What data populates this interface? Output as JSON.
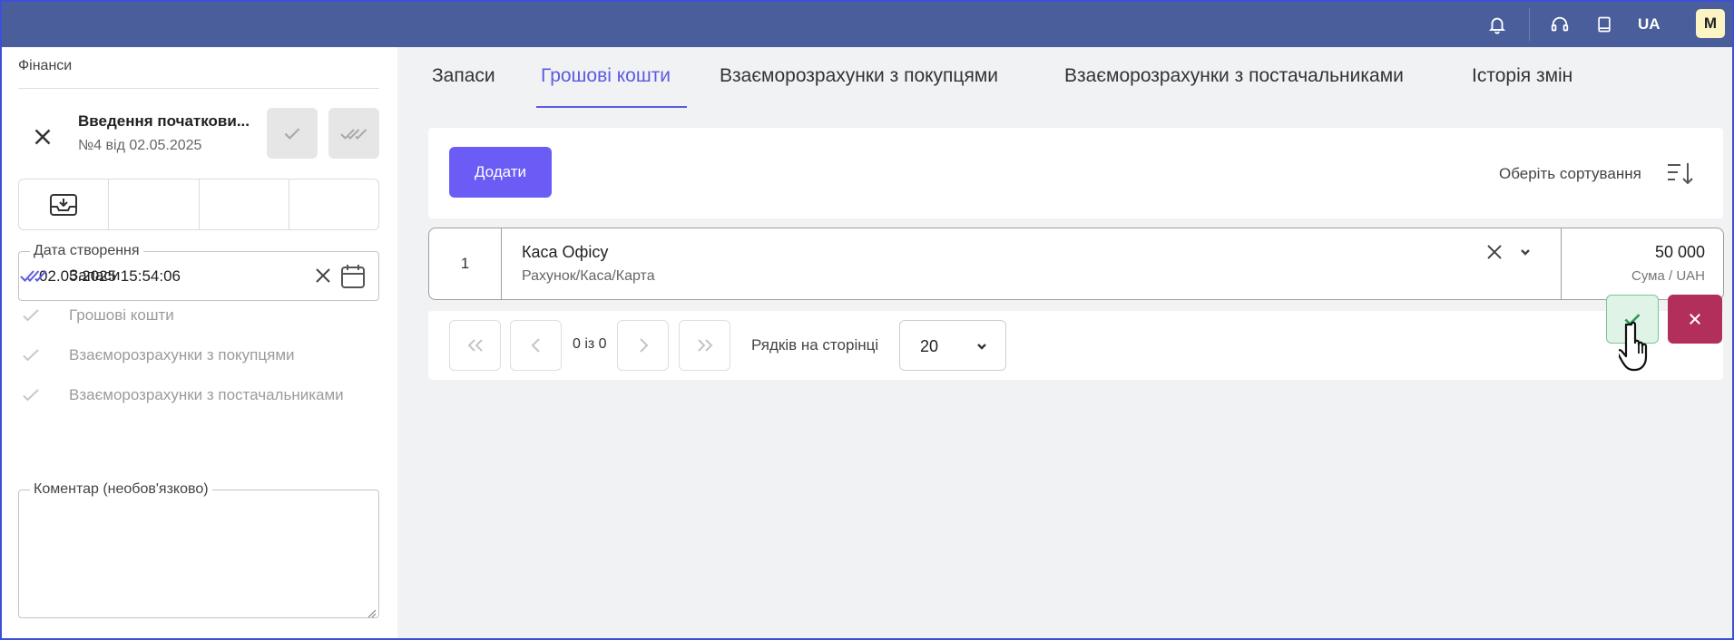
{
  "topbar": {
    "icons": [
      "bell-icon",
      "headset-icon",
      "book-icon"
    ],
    "language": "UA",
    "avatar": "M"
  },
  "sidebar": {
    "section": "Фінанси",
    "document": {
      "title": "Введення початкови...",
      "subtitle": "№4 від 02.05.2025"
    },
    "created_field": {
      "label": "Дата створення",
      "value": "02.05.2025 15:54:06"
    },
    "steps": [
      {
        "label": "Запаси",
        "state": "done"
      },
      {
        "label": "Грошові кошти",
        "state": "pending"
      },
      {
        "label": "Взаєморозрахунки з покупцями",
        "state": "pending"
      },
      {
        "label": "Взаєморозрахунки з постачальниками",
        "state": "pending"
      }
    ],
    "comment": {
      "label": "Коментар (необов'язково)",
      "value": ""
    }
  },
  "tabs": [
    {
      "label": "Запаси",
      "active": false
    },
    {
      "label": "Грошові кошти",
      "active": true
    },
    {
      "label": "Взаєморозрахунки з покупцями",
      "active": false
    },
    {
      "label": "Взаєморозрахунки з постачальниками",
      "active": false
    },
    {
      "label": "Історія змін",
      "active": false
    }
  ],
  "toolbar": {
    "add_label": "Додати",
    "sort_label": "Оберіть сортування"
  },
  "rows": [
    {
      "number": "1",
      "name": "Каса Офісу",
      "hint": "Рахунок/Каса/Карта",
      "amount": "50 000",
      "unit": "Сума / UAH"
    }
  ],
  "pager": {
    "info": "0 із 0",
    "rows_label": "Рядків на сторінці",
    "rows_value": "20"
  },
  "colors": {
    "topbar": "#4a5e9c",
    "accent": "#5b5be0",
    "add_button": "#6b5cf6",
    "confirm": "#2d9a56",
    "cancel": "#b12f5a"
  }
}
